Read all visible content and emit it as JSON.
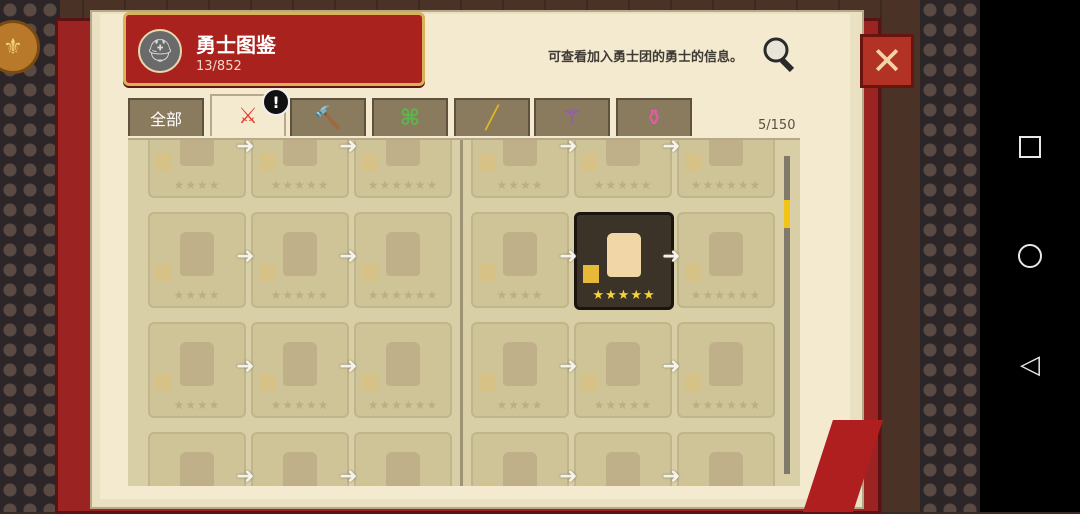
{
  "header": {
    "title": "勇士图鉴",
    "count": "13/852",
    "info": "可查看加入勇士团的勇士的信息。"
  },
  "tabs": [
    {
      "label": "全部",
      "icon": "text",
      "active": false
    },
    {
      "label": "",
      "icon": "sword-icon",
      "color": "#e23a2a",
      "active": true
    },
    {
      "label": "",
      "icon": "hammer-icon",
      "color": "#3a8ad8",
      "active": false
    },
    {
      "label": "",
      "icon": "bow-icon",
      "color": "#5ab84a",
      "active": false
    },
    {
      "label": "",
      "icon": "gun-icon",
      "color": "#e6b81a",
      "active": false
    },
    {
      "label": "",
      "icon": "staff-icon",
      "color": "#9a4ad8",
      "active": false
    },
    {
      "label": "",
      "icon": "potion-icon",
      "color": "#e85aa8",
      "active": false
    }
  ],
  "tab_badge": "!",
  "page_counter": "5/150",
  "rows": [
    [
      "★★★★",
      "★★★★★",
      "★★★★★★",
      "★★★★",
      "★★★★★",
      "★★★★★★"
    ],
    [
      "★★★★",
      "★★★★★",
      "★★★★★★",
      "★★★★",
      "★★★★★",
      "★★★★★★"
    ],
    [
      "★★★★",
      "★★★★★",
      "★★★★★★",
      "★★★★",
      "★★★★★",
      "★★★★★★"
    ],
    [
      "",
      "",
      "",
      "",
      "",
      ""
    ]
  ],
  "highlighted_card": {
    "row": 1,
    "col": 4
  },
  "arrow_glyph": "➜",
  "close_glyph": "✕",
  "colors": {
    "book_cover": "#9b2422",
    "title_plate": "#a9221e",
    "gold_stars": "#f6d23c",
    "scroll_thumb": "#f0c518"
  }
}
